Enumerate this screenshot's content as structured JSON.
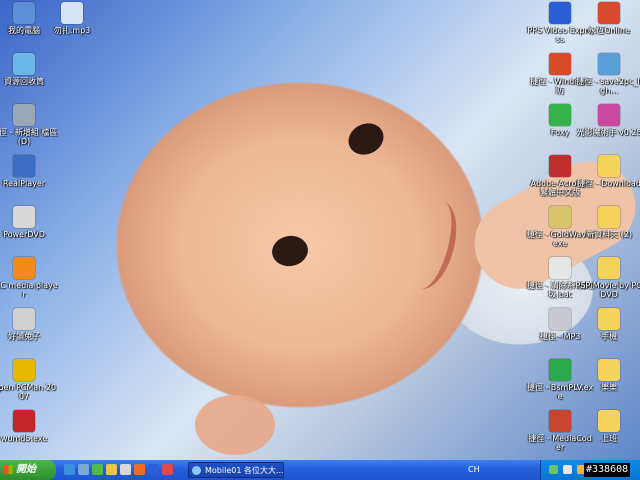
{
  "desktop_icons_left": [
    {
      "label": "我的電腦",
      "icon": "computer-icon",
      "color": "#5a8fd6"
    },
    {
      "label": "資源回收筒",
      "icon": "recycle-bin-icon",
      "color": "#6db6e8"
    },
    {
      "label": "捷徑 - 新增組 檔區 (D)",
      "icon": "drive-icon",
      "color": "#9aa7b8"
    },
    {
      "label": "RealPlayer",
      "icon": "realplayer-icon",
      "color": "#3b6dc4"
    },
    {
      "label": "PowerDVD",
      "icon": "powerdvd-icon",
      "color": "#d8d8d8"
    },
    {
      "label": "VLC media player",
      "icon": "vlc-icon",
      "color": "#f28a1c"
    },
    {
      "label": "好讀兔子",
      "icon": "rabbit-icon",
      "color": "#d0d0d0"
    },
    {
      "label": "Open PCMan 2007",
      "icon": "pcman-icon",
      "color": "#e6b800"
    },
    {
      "label": "wumd5.exe",
      "icon": "md5-icon",
      "color": "#c0262b"
    }
  ],
  "desktop_icons_second": [
    {
      "label": "勿扎.mp3",
      "icon": "music-file-icon",
      "color": "#d5e3f5"
    }
  ],
  "desktop_icons_right1": [
    {
      "label": "PPS Video Express",
      "icon": "pps-icon",
      "color": "#2c5ed8"
    },
    {
      "label": "捷徑 - Windows 防",
      "icon": "windows-firewall-icon",
      "color": "#d94a2a"
    },
    {
      "label": "Foxy",
      "icon": "foxy-icon",
      "color": "#36b24a"
    },
    {
      "label": "Adobe Acrobat 繁體中文版",
      "icon": "acrobat-icon",
      "color": "#c12c2c"
    },
    {
      "label": "捷徑 - GoldWave.exe",
      "icon": "goldwave-icon",
      "color": "#d8c46a"
    },
    {
      "label": "捷徑 - 清除系 統垃圾.bat",
      "icon": "batch-file-icon",
      "color": "#e6e6e6"
    },
    {
      "label": "捷徑 - MP3",
      "icon": "cd-icon",
      "color": "#c8c8d0"
    },
    {
      "label": "捷徑 - BsmPLV.exe",
      "icon": "flv-icon",
      "color": "#2aa84a"
    },
    {
      "label": "捷徑 - MediaCoder",
      "icon": "mediacoder-icon",
      "color": "#c9432f"
    }
  ],
  "desktop_icons_right2": [
    {
      "label": "永恆Online",
      "icon": "game-icon",
      "color": "#d9492d"
    },
    {
      "label": "捷徑 - save2pc_ligh...",
      "icon": "save2pc-icon",
      "color": "#5aa0d8"
    },
    {
      "label": "光影魔術手 v0.25",
      "icon": "camera-icon",
      "color": "#c84aa0"
    },
    {
      "label": "捷徑 - Download",
      "icon": "folder-icon",
      "color": "#f3d35b"
    },
    {
      "label": "新資料夾 (2)",
      "icon": "folder-icon",
      "color": "#f3d35b"
    },
    {
      "label": "PSP Movie by PQDVD",
      "icon": "folder-icon",
      "color": "#f3d35b"
    },
    {
      "label": "手機",
      "icon": "folder-icon",
      "color": "#f3d35b"
    },
    {
      "label": "樂樂",
      "icon": "folder-icon",
      "color": "#f3d35b"
    },
    {
      "label": "上班",
      "icon": "folder-icon",
      "color": "#f3d35b"
    }
  ],
  "taskbar": {
    "start_label": "開始",
    "quick_launch": [
      "ie-icon",
      "desktop-icon",
      "msn-icon",
      "mail-icon",
      "media-icon",
      "player-icon",
      "pps-icon",
      "flag-icon"
    ],
    "window_title": "Mobile01 各位大大...",
    "language": "CH"
  },
  "watermark": "#338608"
}
